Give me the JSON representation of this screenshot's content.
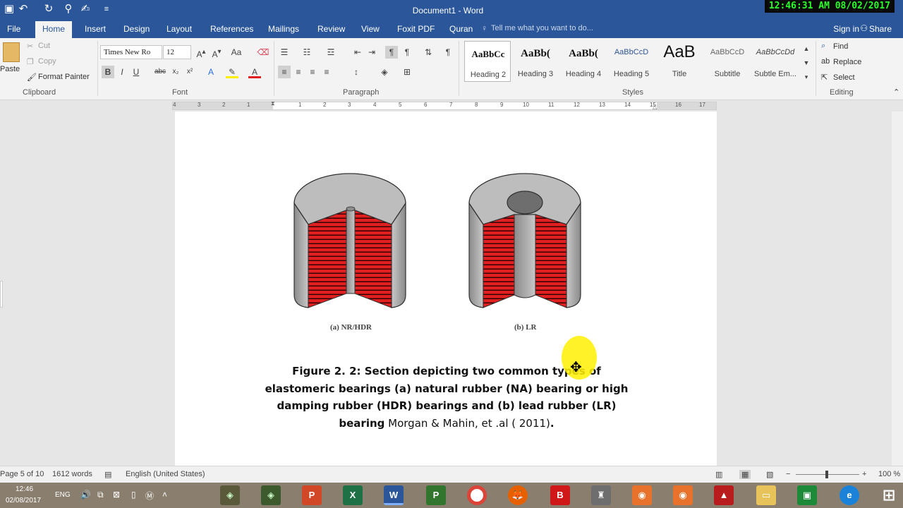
{
  "window": {
    "title": "Document1 - Word",
    "clock": "12:46:31 AM 08/02/2017"
  },
  "tabs": [
    "File",
    "Home",
    "Insert",
    "Design",
    "Layout",
    "References",
    "Mailings",
    "Review",
    "View",
    "Foxit PDF",
    "Quran"
  ],
  "active_tab": "Home",
  "tell_me": "Tell me what you want to do...",
  "account": {
    "sign_in": "Sign in",
    "share": "Share"
  },
  "clipboard": {
    "paste": "Paste",
    "cut": "Cut",
    "copy": "Copy",
    "format_painter": "Format Painter",
    "label": "Clipboard"
  },
  "font": {
    "name": "Times New Ro",
    "size": "12",
    "label": "Font"
  },
  "paragraph": {
    "label": "Paragraph"
  },
  "styles": {
    "label": "Styles",
    "items": [
      {
        "sample": "AaBbCc",
        "name": "Heading 2"
      },
      {
        "sample": "AaBb(",
        "name": "Heading 3"
      },
      {
        "sample": "AaBb(",
        "name": "Heading 4"
      },
      {
        "sample": "AaBbCcD",
        "name": "Heading 5"
      },
      {
        "sample": "AaB",
        "name": "Title"
      },
      {
        "sample": "AaBbCcD",
        "name": "Subtitle"
      },
      {
        "sample": "AaBbCcDd",
        "name": "Subtle Em..."
      }
    ]
  },
  "editing": {
    "find": "Find",
    "replace": "Replace",
    "select": "Select",
    "label": "Editing"
  },
  "ruler": [
    "4",
    "3",
    "2",
    "1",
    "1",
    "2",
    "3",
    "4",
    "5",
    "6",
    "7",
    "8",
    "9",
    "10",
    "11",
    "12",
    "13",
    "14",
    "15",
    "16",
    "17"
  ],
  "figure": {
    "label_a": "(a) NR/HDR",
    "label_b": "(b) LR",
    "caption_bold": "Figure 2. 2: Section depicting two common types of elastomeric bearings (a) natural rubber (NA) bearing or high damping rubber (HDR) bearings and (b) lead rubber (LR) bearing",
    "caption_normal": " Morgan & Mahin, et .al ( 2011)",
    "caption_end": "."
  },
  "status": {
    "page": "Page 5 of 10",
    "words": "1612 words",
    "language": "English (United States)",
    "zoom": "100 %"
  },
  "taskbar": {
    "time": "12:46",
    "date": "02/08/2017",
    "lang": "ENG",
    "apps": [
      "P",
      "X",
      "W",
      "P",
      "B"
    ]
  },
  "colors": {
    "word_blue": "#2b579a",
    "rubber_red": "#e02020",
    "steel_gray": "#a8a8a8",
    "highlight": "#fff000"
  }
}
